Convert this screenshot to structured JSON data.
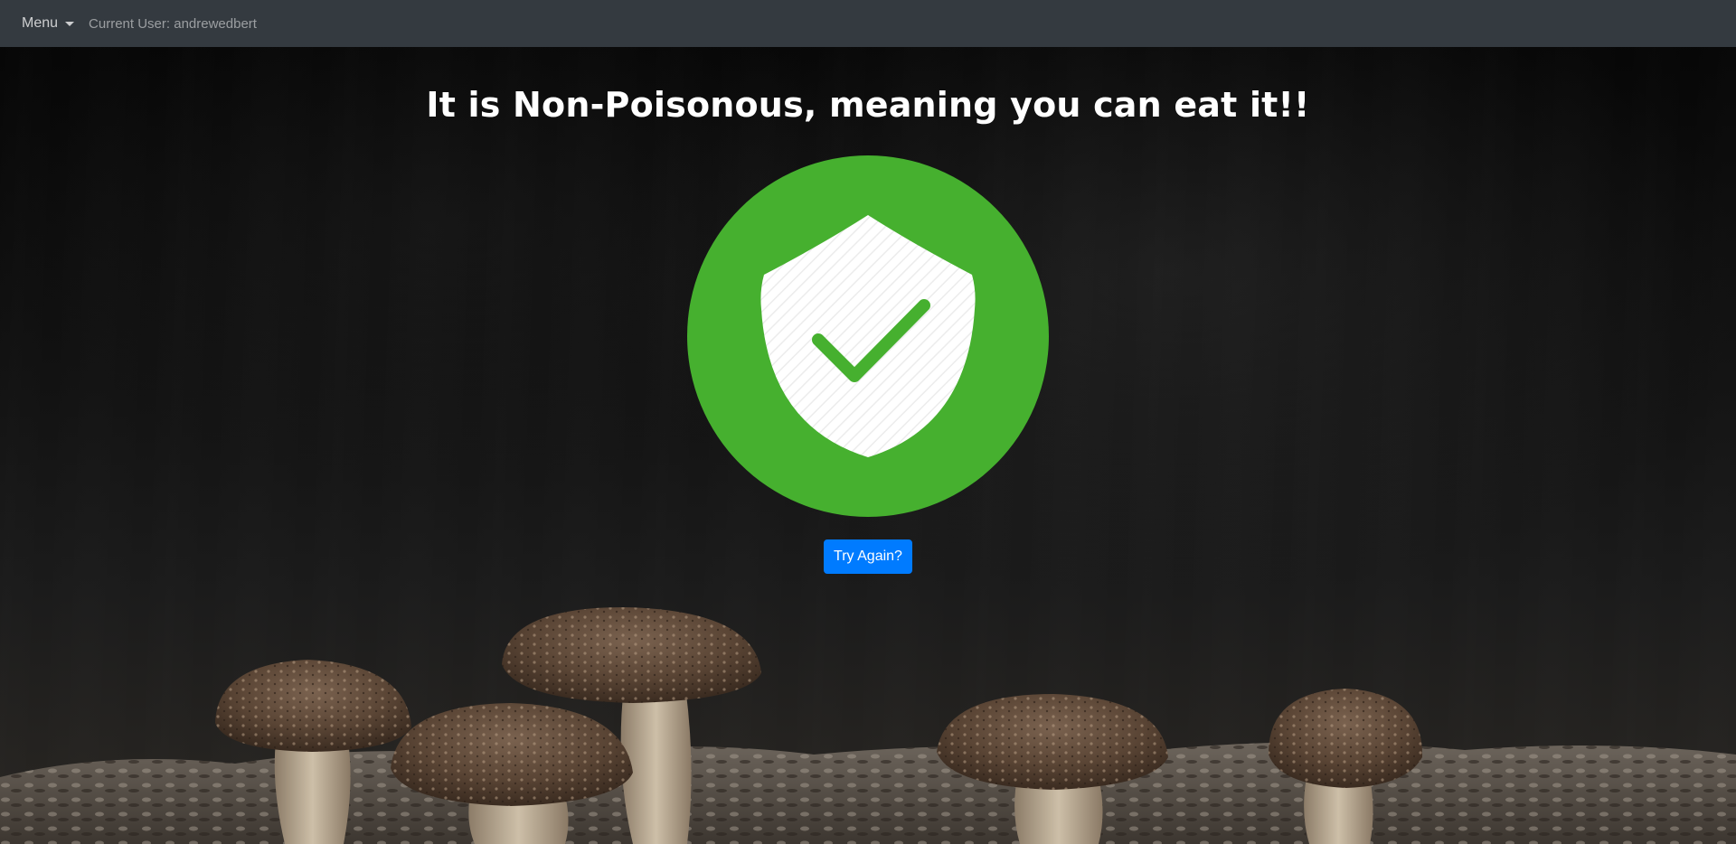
{
  "navbar": {
    "menu_label": "Menu",
    "user_label": "Current User: andrewedbert"
  },
  "main": {
    "result_title": "It is Non-Poisonous, meaning you can eat it!!",
    "try_again_label": "Try Again?",
    "result_icon": "shield-check-icon"
  },
  "colors": {
    "navbar": "#343a40",
    "badge_green": "#46b02f",
    "button_blue": "#007bff"
  }
}
